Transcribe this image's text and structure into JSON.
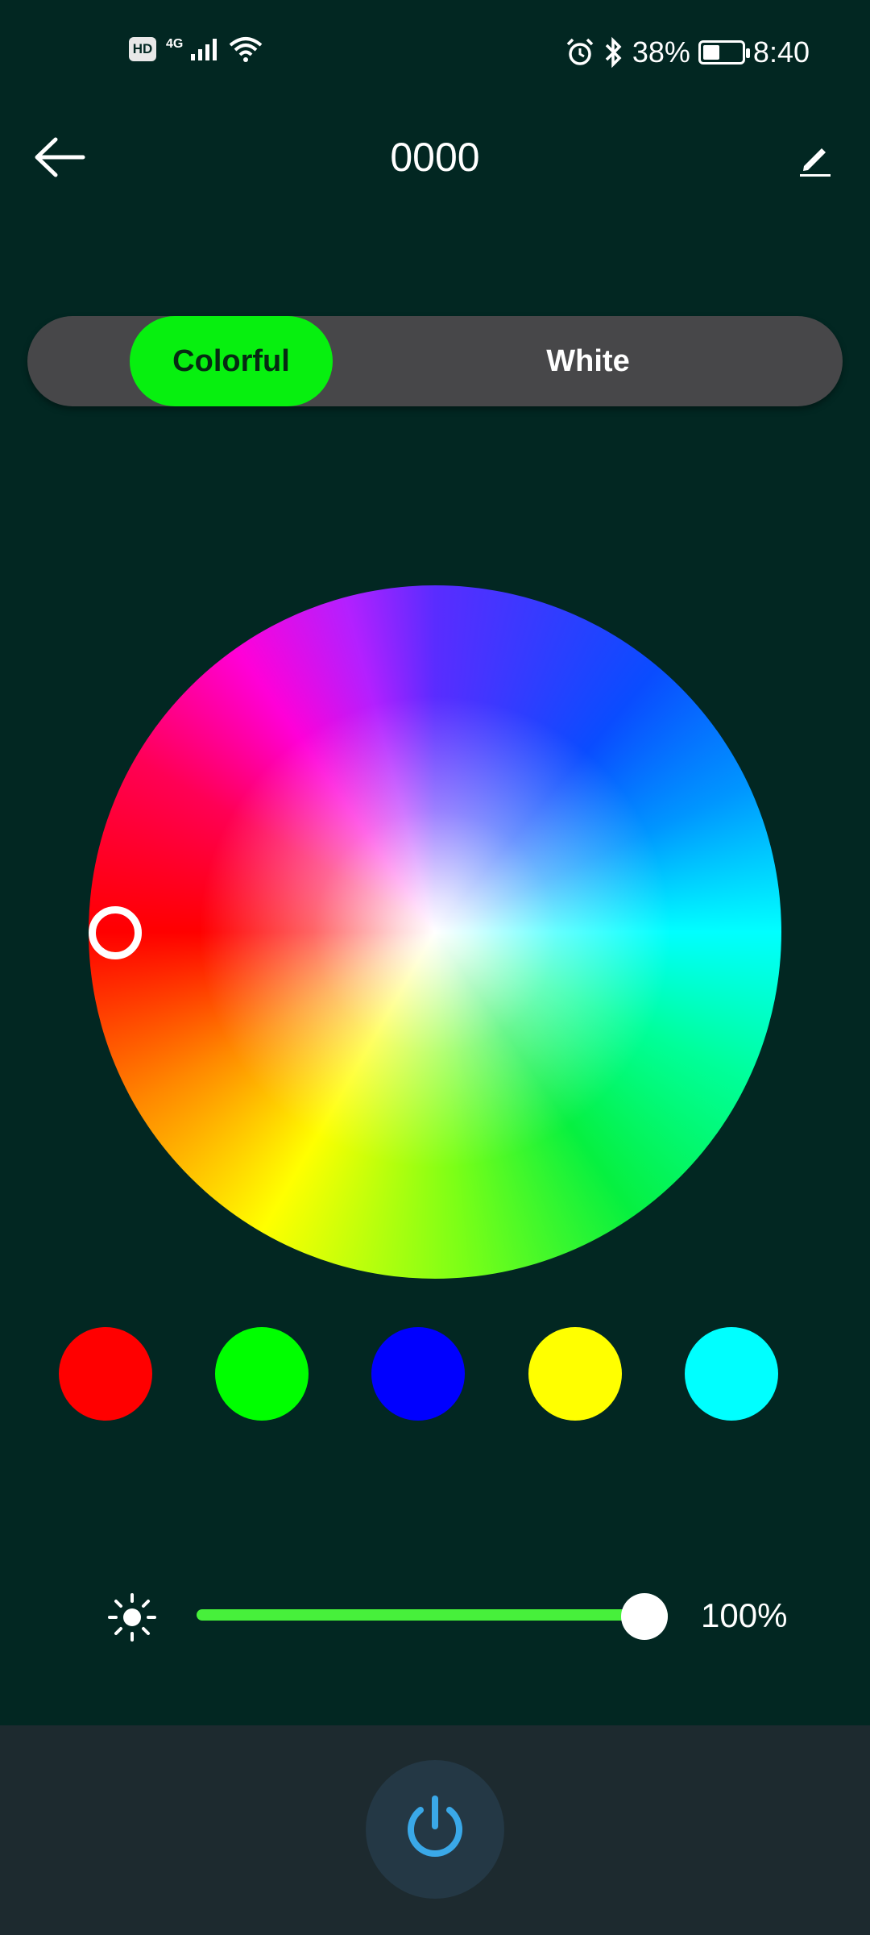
{
  "status_bar": {
    "hd_badge": "HD",
    "network_type": "4G",
    "battery_percent": "38%",
    "time": "8:40",
    "icons": [
      "hd-icon",
      "signal-icon",
      "wifi-icon",
      "alarm-icon",
      "bluetooth-icon",
      "battery-icon"
    ]
  },
  "header": {
    "title": "0000",
    "back_icon": "arrow-left-icon",
    "edit_icon": "pencil-icon"
  },
  "mode_tabs": [
    {
      "label": "Colorful",
      "active": true
    },
    {
      "label": "White",
      "active": false
    }
  ],
  "color_wheel": {
    "selected_color": "#ff0000"
  },
  "presets": [
    {
      "color": "#ff0000"
    },
    {
      "color": "#00ff00"
    },
    {
      "color": "#0000ff"
    },
    {
      "color": "#ffff00"
    },
    {
      "color": "#00ffff"
    }
  ],
  "brightness": {
    "icon": "brightness-icon",
    "level": 1.0,
    "value_text": "100%"
  },
  "power": {
    "icon": "power-icon",
    "color": "#3aa8e8"
  },
  "colors": {
    "background": "#022722",
    "accent": "#07f00f",
    "bottom_bar": "#1d2a2f"
  }
}
